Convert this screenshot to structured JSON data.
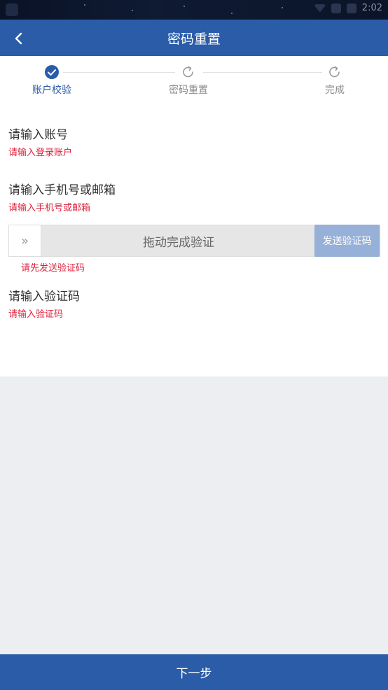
{
  "status_bar": {
    "time": "2:02"
  },
  "nav": {
    "title": "密码重置",
    "back_icon": "chevron-left-icon"
  },
  "steps": [
    {
      "label": "账户校验",
      "state": "done",
      "icon": "check-circle-icon"
    },
    {
      "label": "密码重置",
      "state": "pending",
      "icon": "refresh-icon"
    },
    {
      "label": "完成",
      "state": "pending",
      "icon": "refresh-icon"
    }
  ],
  "form": {
    "account": {
      "title": "请输入账号",
      "error": "请输入登录账户"
    },
    "phone_email": {
      "title": "请输入手机号或邮箱",
      "error": "请输入手机号或邮箱"
    },
    "slider": {
      "handle_glyph": "»",
      "text": "拖动完成验证",
      "send_code_label": "发送验证码",
      "error": "请先发送验证码"
    },
    "code": {
      "title": "请输入验证码",
      "error": "请输入验证码"
    }
  },
  "footer": {
    "next_label": "下一步"
  },
  "colors": {
    "primary": "#2a5ca8",
    "error": "#e0223c",
    "disabled_button": "#97b0d8",
    "background": "#eceef2"
  }
}
